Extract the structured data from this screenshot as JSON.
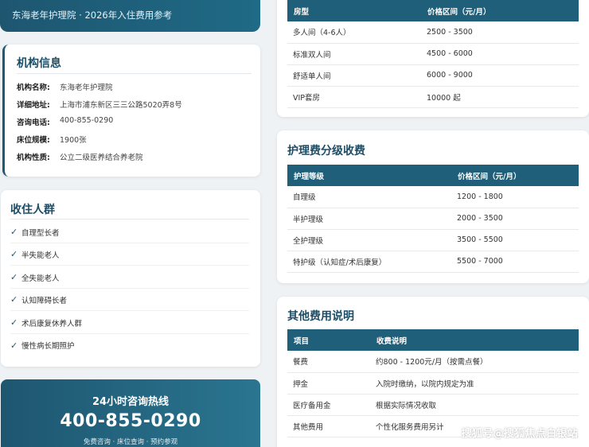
{
  "banner": {
    "subtitle": "东海老年护理院 · 2026年入住费用参考"
  },
  "info": {
    "title": "机构信息",
    "rows": [
      {
        "key": "机构名称:",
        "value": "东海老年护理院"
      },
      {
        "key": "详细地址:",
        "value": "上海市浦东新区三三公路5020弄8号"
      },
      {
        "key": "咨询电话:",
        "value": "400-855-0290"
      },
      {
        "key": "床位规模:",
        "value": "1900张"
      },
      {
        "key": "机构性质:",
        "value": "公立二级医养结合养老院"
      }
    ]
  },
  "crowd": {
    "title": "收住人群",
    "check_icon": "check-icon",
    "items": [
      "自理型长者",
      "半失能老人",
      "全失能老人",
      "认知障碍长者",
      "术后康复休养人群",
      "慢性病长期照护"
    ]
  },
  "hotline": {
    "title": "24小时咨询热线",
    "number": "400-855-0290",
    "subtitle": "免费咨询 · 床位查询 · 预约参观"
  },
  "room_fees": {
    "headers": [
      "房型",
      "价格区间（元/月）"
    ],
    "rows": [
      [
        "多人间（4-6人）",
        "2500 - 3500"
      ],
      [
        "标准双人间",
        "4500 - 6000"
      ],
      [
        "舒适单人间",
        "6000 - 9000"
      ],
      [
        "VIP套房",
        "10000 起"
      ]
    ]
  },
  "care_fees": {
    "title": "护理费分级收费",
    "headers": [
      "护理等级",
      "价格区间（元/月）"
    ],
    "rows": [
      [
        "自理级",
        "1200 - 1800"
      ],
      [
        "半护理级",
        "2000 - 3500"
      ],
      [
        "全护理级",
        "3500 - 5500"
      ],
      [
        "特护级（认知症/术后康复）",
        "5500 - 7000"
      ]
    ]
  },
  "other_fees": {
    "title": "其他费用说明",
    "headers": [
      "项目",
      "收费说明"
    ],
    "rows": [
      [
        "餐费",
        "约800 - 1200元/月（按需点餐）"
      ],
      [
        "押金",
        "入院时缴纳，以院内规定为准"
      ],
      [
        "医疗备用金",
        "根据实际情况收取"
      ],
      [
        "其他费用",
        "个性化服务费用另计"
      ]
    ]
  },
  "watermark": "搜狐号@搜狐焦点白银站",
  "colors": {
    "primary": "#1e5a73",
    "header": "#1f5f7a",
    "background": "#eef2f5"
  }
}
